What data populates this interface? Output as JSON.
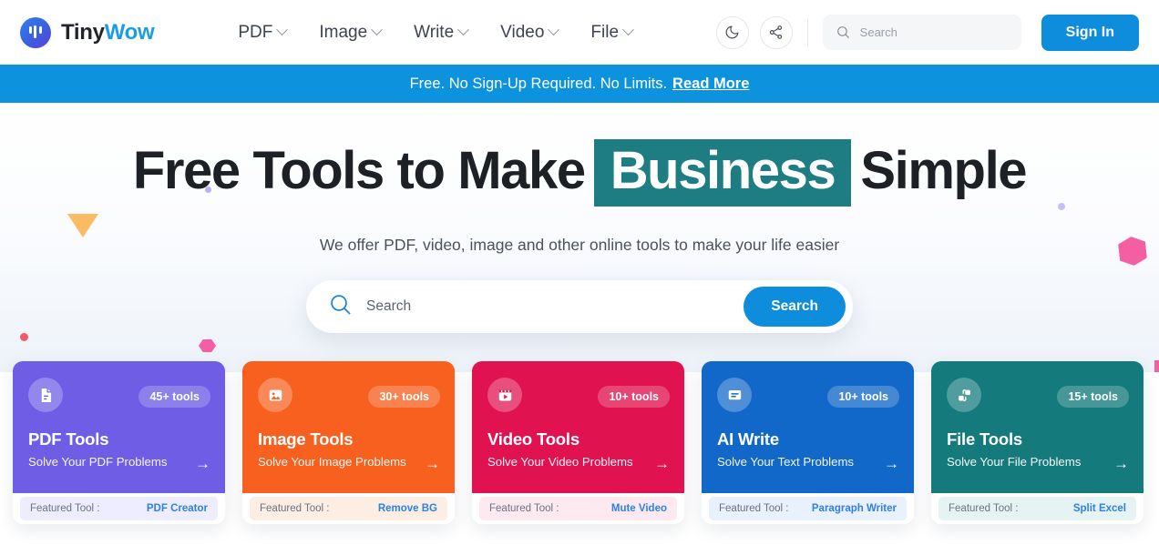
{
  "header": {
    "brand": {
      "first": "Tiny",
      "second": "Wow"
    },
    "nav": [
      {
        "label": "PDF",
        "icon": "chevron-down-icon"
      },
      {
        "label": "Image",
        "icon": "chevron-down-icon"
      },
      {
        "label": "Write",
        "icon": "chevron-down-icon"
      },
      {
        "label": "Video",
        "icon": "chevron-down-icon"
      },
      {
        "label": "File",
        "icon": "chevron-down-icon"
      }
    ],
    "dark_mode_icon": "moon-icon",
    "share_icon": "share-icon",
    "search": {
      "placeholder": "Search",
      "value": "",
      "icon": "search-icon"
    },
    "sign_in_label": "Sign In"
  },
  "banner": {
    "text": "Free. No Sign-Up Required. No Limits.",
    "link_label": "Read More",
    "bg_color": "#0d93de"
  },
  "hero": {
    "headline_part1": "Free Tools to Make",
    "headline_highlight": "Business",
    "headline_part2": "Simple",
    "highlight_color": "#1d7d82",
    "subtitle": "We offer PDF, video, image and other online tools to make your life easier",
    "search": {
      "placeholder": "Search",
      "value": "",
      "button_label": "Search",
      "icon": "search-icon"
    }
  },
  "cards": [
    {
      "title": "PDF Tools",
      "subtitle": "Solve Your PDF Problems",
      "badge": "45+ tools",
      "icon": "document-icon",
      "color": "#6f5de6",
      "foot_label": "Featured Tool :",
      "foot_tool": "PDF Creator",
      "foot_bg": "#eeedfd",
      "foot_tool_color": "#2f7fe8",
      "arrow_icon": "arrow-right-icon"
    },
    {
      "title": "Image Tools",
      "subtitle": "Solve Your Image Problems",
      "badge": "30+ tools",
      "icon": "image-icon",
      "color": "#f7601f",
      "foot_label": "Featured Tool :",
      "foot_tool": "Remove BG",
      "foot_bg": "#fdeee4",
      "foot_tool_color": "#2f7fe8",
      "arrow_icon": "arrow-right-icon"
    },
    {
      "title": "Video Tools",
      "subtitle": "Solve Your Video Problems",
      "badge": "10+ tools",
      "icon": "video-icon",
      "color": "#e0124f",
      "foot_label": "Featured Tool :",
      "foot_tool": "Mute Video",
      "foot_bg": "#fdeaf0",
      "foot_tool_color": "#2f7fe8",
      "arrow_icon": "arrow-right-icon"
    },
    {
      "title": "AI Write",
      "subtitle": "Solve Your Text Problems",
      "badge": "10+ tools",
      "icon": "text-lines-icon",
      "color": "#1168c9",
      "foot_label": "Featured Tool :",
      "foot_tool": "Paragraph Writer",
      "foot_bg": "#e9f1fc",
      "foot_tool_color": "#2f7fe8",
      "arrow_icon": "arrow-right-icon"
    },
    {
      "title": "File Tools",
      "subtitle": "Solve Your File Problems",
      "badge": "15+ tools",
      "icon": "convert-icon",
      "color": "#147a7c",
      "foot_label": "Featured Tool :",
      "foot_tool": "Split Excel",
      "foot_bg": "#e6f3f3",
      "foot_tool_color": "#2f7fe8",
      "arrow_icon": "arrow-right-icon"
    }
  ]
}
